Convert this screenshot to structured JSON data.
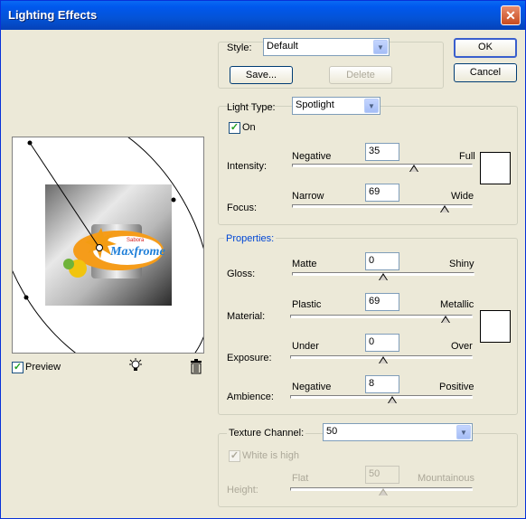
{
  "window": {
    "title": "Lighting Effects"
  },
  "buttons": {
    "ok": "OK",
    "cancel": "Cancel",
    "save": "Save...",
    "delete": "Delete"
  },
  "style": {
    "label": "Style:",
    "value": "Default"
  },
  "light_type": {
    "label": "Light Type:",
    "value": "Spotlight",
    "on_label": "On",
    "on_checked": true
  },
  "intensity": {
    "label": "Intensity:",
    "left": "Negative",
    "right": "Full",
    "value": "35"
  },
  "focus": {
    "label": "Focus:",
    "left": "Narrow",
    "right": "Wide",
    "value": "69"
  },
  "properties": {
    "header": "Properties:",
    "gloss": {
      "label": "Gloss:",
      "left": "Matte",
      "right": "Shiny",
      "value": "0"
    },
    "material": {
      "label": "Material:",
      "left": "Plastic",
      "right": "Metallic",
      "value": "69"
    },
    "exposure": {
      "label": "Exposure:",
      "left": "Under",
      "right": "Over",
      "value": "0"
    },
    "ambience": {
      "label": "Ambience:",
      "left": "Negative",
      "right": "Positive",
      "value": "8"
    }
  },
  "texture": {
    "label": "Texture Channel:",
    "value": "50",
    "white_is_high": "White is high",
    "height_label": "Height:",
    "left": "Flat",
    "right": "Mountainous"
  },
  "preview": {
    "label": "Preview",
    "checked": true,
    "product_brand": "Maxfrome",
    "product_small": "Sabora"
  },
  "icons": {
    "light": "light-bulb-icon",
    "trash": "trash-icon"
  },
  "colors": {
    "title_blue": "#0058ee",
    "properties_header": "#0046d5",
    "light_color": "#ffffff",
    "ambient_color": "#ffffff"
  }
}
